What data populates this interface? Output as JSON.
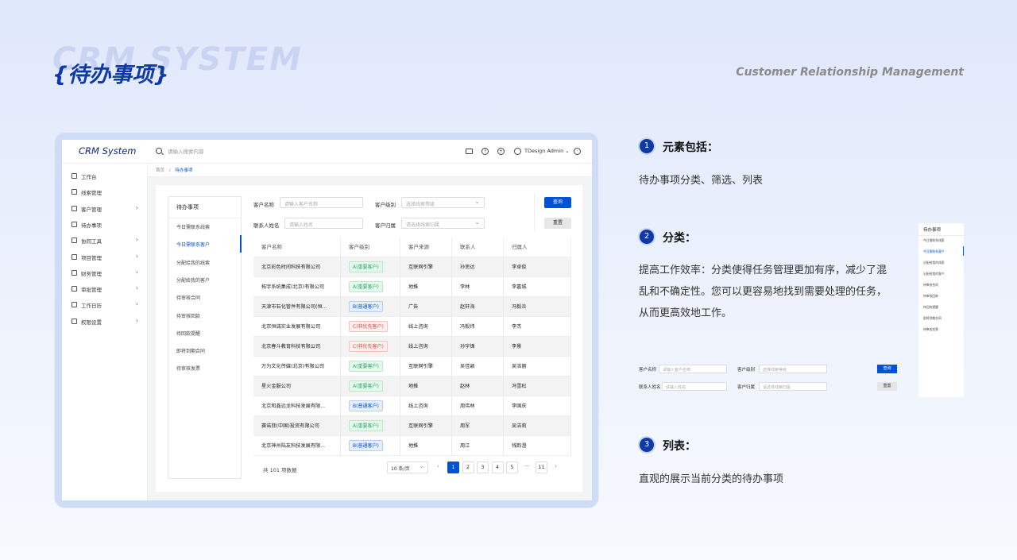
{
  "header": {
    "bg_text": "CRM  SYSTEM",
    "title": "{待办事项}",
    "subtitle": "Customer Relationship Management"
  },
  "app": {
    "logo": "CRM System",
    "search_placeholder": "请输入搜索内容",
    "user": "TDesign Admin ⌄",
    "nav": [
      {
        "label": "工作台",
        "chevron": ""
      },
      {
        "label": "线索管理",
        "chevron": ""
      },
      {
        "label": "客户管理",
        "chevron": "›"
      },
      {
        "label": "待办事项",
        "chevron": ""
      },
      {
        "label": "协同工具",
        "chevron": "›"
      },
      {
        "label": "项目管理",
        "chevron": "›"
      },
      {
        "label": "财务管理",
        "chevron": "›"
      },
      {
        "label": "审批管理",
        "chevron": "›"
      },
      {
        "label": "工作日历",
        "chevron": "›"
      },
      {
        "label": "权限设置",
        "chevron": "›"
      }
    ],
    "breadcrumb": {
      "home": "首页",
      "sep": "/",
      "current": "待办事项"
    },
    "categories": {
      "title": "待办事项",
      "items": [
        "今日需联系线索",
        "今日需联系客户",
        "分配给我的线索",
        "分配给我的客户",
        "待审核合同",
        "待审核回款",
        "待回款提醒",
        "即将到期合同",
        "待审核发票"
      ],
      "active_index": 1
    },
    "filters": {
      "customer_name_label": "客户名称",
      "customer_name_placeholder": "请输入客户名称",
      "level_label": "客户级别",
      "level_placeholder": "选择线索等级",
      "contact_label": "联系人姓名",
      "contact_placeholder": "请输入姓名",
      "owner_label": "客户归属",
      "owner_placeholder": "请选择线索归属",
      "query_button": "查询",
      "reset_button": "重置"
    },
    "table": {
      "headers": [
        "客户名称",
        "客户级别",
        "客户来源",
        "联系人",
        "归属人"
      ],
      "rows": [
        {
          "name": "北京彩色时间科技有限公司",
          "level": "A(重要客户)",
          "level_type": "a",
          "source": "互联网引擎",
          "contact": "孙思达",
          "owner": "李卓俊"
        },
        {
          "name": "拓宇系统集成(北京)有限公司",
          "level": "A(重要客户)",
          "level_type": "a",
          "source": "地推",
          "contact": "李林",
          "owner": "李嘉城"
        },
        {
          "name": "天津市石化管件有限公司(恒...",
          "level": "B(普通客户)",
          "level_type": "b",
          "source": "广告",
          "contact": "赵轩海",
          "owner": "冯毅炎"
        },
        {
          "name": "北京恒诚实业发展有限公司",
          "level": "C(非优先客户)",
          "level_type": "c",
          "source": "线上咨询",
          "contact": "冯毅炜",
          "owner": "李杰"
        },
        {
          "name": "北京春斗教育科技有限公司",
          "level": "C(非优先客户)",
          "level_type": "c",
          "source": "线上咨询",
          "contact": "孙宇锋",
          "owner": "李景"
        },
        {
          "name": "万为文化传媒(北京)有限公司",
          "level": "A(重要客户)",
          "level_type": "a",
          "source": "互联网引擎",
          "contact": "吴佳颖",
          "owner": "吴洁丽"
        },
        {
          "name": "星火金服公司",
          "level": "A(重要客户)",
          "level_type": "a",
          "source": "地推",
          "contact": "赵林",
          "owner": "冯雪松"
        },
        {
          "name": "北京和鑫远龙科技发展有限...",
          "level": "B(普通客户)",
          "level_type": "b",
          "source": "线上咨询",
          "contact": "周伟林",
          "owner": "李国庆"
        },
        {
          "name": "赛诺菲(中国)投资有限公司",
          "level": "A(重要客户)",
          "level_type": "a",
          "source": "互联网引擎",
          "contact": "周军",
          "owner": "吴洁莉"
        },
        {
          "name": "北京神州陆友科技发展有限...",
          "level": "B(普通客户)",
          "level_type": "b",
          "source": "地推",
          "contact": "周江",
          "owner": "钱韵澄"
        }
      ]
    },
    "pagination": {
      "total": "共 101 项数据",
      "page_size": "10 条/页",
      "prev": "‹",
      "next": "›",
      "pages": [
        "1",
        "2",
        "3",
        "4",
        "5",
        "···",
        "11"
      ],
      "current": "1"
    }
  },
  "sections": [
    {
      "num": "1",
      "title": "元素包括：",
      "text": "待办事项分类、筛选、列表"
    },
    {
      "num": "2",
      "title": "分类：",
      "lines": [
        "提高工作效率：分类使得任务管理更加有序，减少了混",
        "乱和不确定性。您可以更容易地找到需要处理的任务，",
        "从而更高效地工作。"
      ]
    },
    {
      "num": "3",
      "title": "列表：",
      "text": "直观的展示当前分类的待办事项"
    }
  ],
  "mini_categories": {
    "title": "待办事项",
    "items": [
      "今日需联系线索",
      "今日需联系客户",
      "分配给我的线索",
      "分配给我的客户",
      "待审核合同",
      "待审核回款",
      "待回款提醒",
      "即将到期合同",
      "待审核发票"
    ]
  },
  "mini_filters": {
    "name_label": "客户名称",
    "name_placeholder": "请输入客户名称",
    "level_label": "客户级别",
    "level_placeholder": "选择线索等级",
    "contact_label": "联系人姓名",
    "contact_placeholder": "请输入姓名",
    "owner_label": "客户归属",
    "owner_placeholder": "请选择线索归属",
    "query": "查询",
    "reset": "重置"
  },
  "colors": {
    "primary": "#0052d9",
    "title": "#0e3aa5",
    "tag_a": "#2ba471",
    "tag_b": "#0052d9",
    "tag_c": "#d54941"
  }
}
